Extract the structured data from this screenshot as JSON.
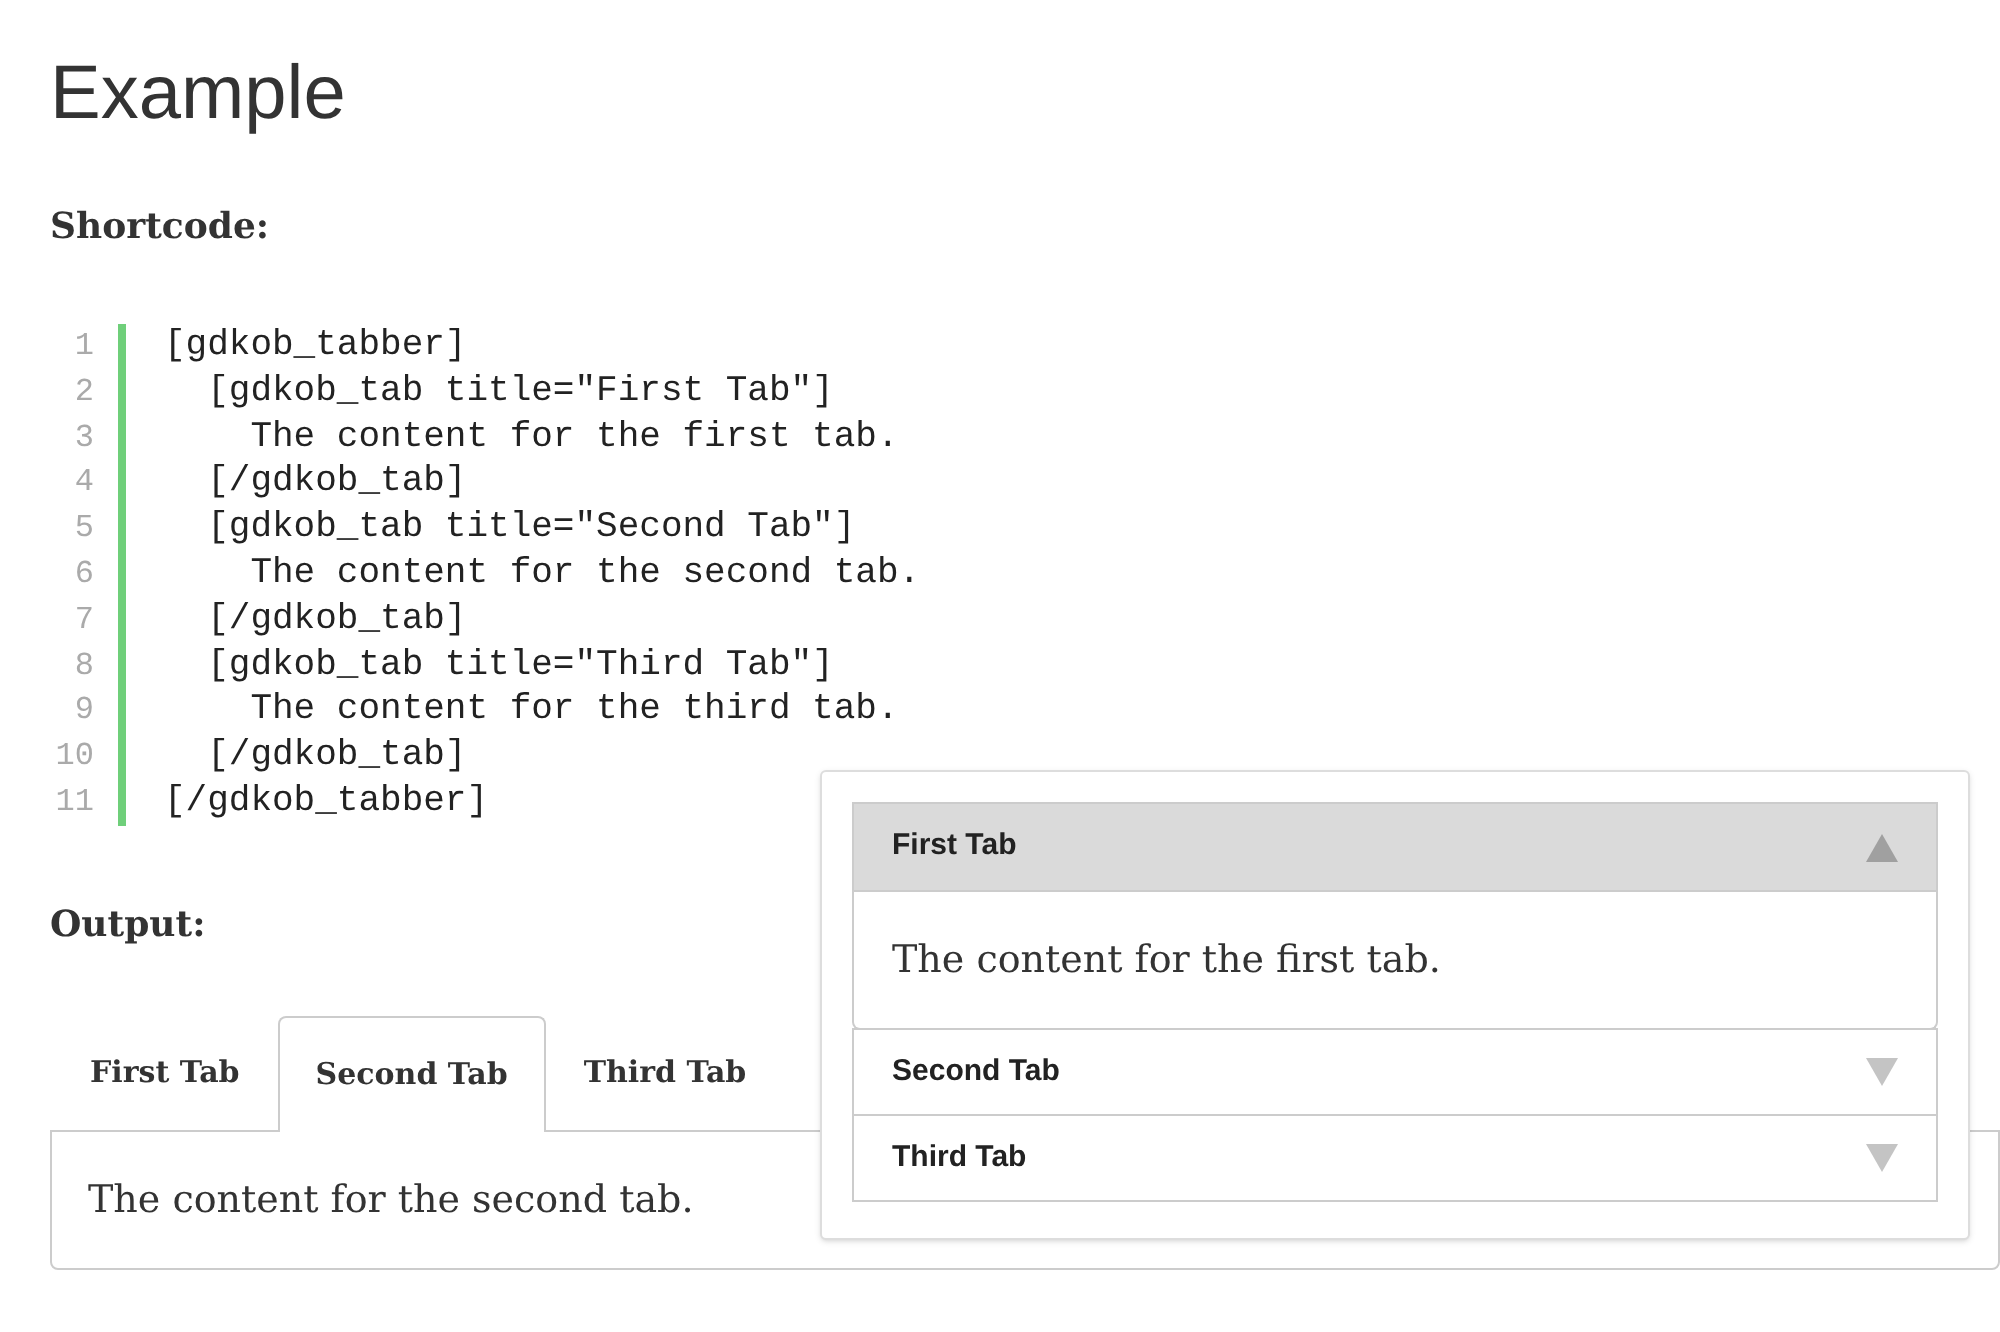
{
  "heading": "Example",
  "shortcode_label": "Shortcode:",
  "code": {
    "lines": [
      {
        "number": "1",
        "text": "[gdkob_tabber]"
      },
      {
        "number": "2",
        "text": "  [gdkob_tab title=\"First Tab\"]"
      },
      {
        "number": "3",
        "text": "    The content for the first tab."
      },
      {
        "number": "4",
        "text": "  [/gdkob_tab]"
      },
      {
        "number": "5",
        "text": "  [gdkob_tab title=\"Second Tab\"]"
      },
      {
        "number": "6",
        "text": "    The content for the second tab."
      },
      {
        "number": "7",
        "text": "  [/gdkob_tab]"
      },
      {
        "number": "8",
        "text": "  [gdkob_tab title=\"Third Tab\"]"
      },
      {
        "number": "9",
        "text": "    The content for the third tab."
      },
      {
        "number": "10",
        "text": "  [/gdkob_tab]"
      },
      {
        "number": "11",
        "text": "[/gdkob_tabber]"
      }
    ]
  },
  "output_label": "Output:",
  "tabs": [
    {
      "label": "First Tab",
      "selected": false
    },
    {
      "label": "Second Tab",
      "selected": true
    },
    {
      "label": "Third Tab",
      "selected": false
    }
  ],
  "tab_content": "The content for the second tab.",
  "accordion": [
    {
      "title": "First Tab",
      "expanded": true,
      "content": "The content for the first tab."
    },
    {
      "title": "Second Tab",
      "expanded": false
    },
    {
      "title": "Third Tab",
      "expanded": false
    }
  ]
}
